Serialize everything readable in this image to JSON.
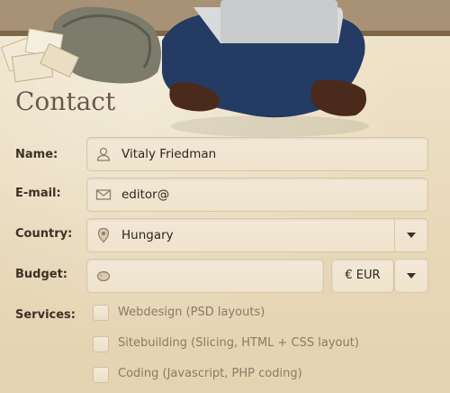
{
  "page": {
    "title": "Contact"
  },
  "form": {
    "name": {
      "label": "Name:",
      "value": "Vitaly Friedman",
      "icon": "user-icon"
    },
    "email": {
      "label": "E-mail:",
      "value": "editor@",
      "icon": "envelope-icon"
    },
    "country": {
      "label": "Country:",
      "value": "Hungary",
      "icon": "location-pin-icon"
    },
    "budget": {
      "label": "Budget:",
      "value": "",
      "icon": "piggy-bank-icon",
      "currency": "€ EUR"
    },
    "services": {
      "label": "Services:",
      "options": [
        {
          "label": "Webdesign (PSD layouts)",
          "checked": false
        },
        {
          "label": "Sitebuilding (Slicing, HTML + CSS layout)",
          "checked": false
        },
        {
          "label": "Coding (Javascript, PHP coding)",
          "checked": false
        }
      ]
    }
  },
  "colors": {
    "background": "#e9dcc0",
    "field": "#f0e5cf",
    "field_border": "#d8c7a8",
    "label": "#3d3126",
    "title": "#6b5846"
  }
}
